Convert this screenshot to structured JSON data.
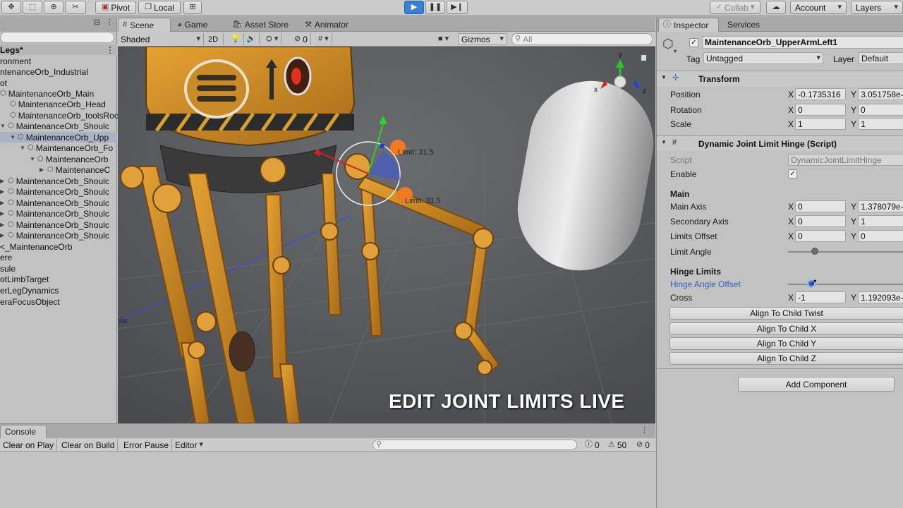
{
  "toolbar": {
    "pivot_label": "Pivot",
    "local_label": "Local",
    "collab_label": "Collab",
    "account_label": "Account",
    "layers_label": "Layers"
  },
  "hierarchy": {
    "rows": [
      {
        "label": "Legs*",
        "bold": true
      },
      {
        "label": "ronment"
      },
      {
        "label": "ntenanceOrb_Industrial"
      },
      {
        "label": "ot"
      },
      {
        "label": "MaintenanceOrb_Main"
      },
      {
        "label": "MaintenanceOrb_Head"
      },
      {
        "label": "MaintenanceOrb_toolsRoo"
      },
      {
        "label": "MaintenanceOrb_Shoulc"
      },
      {
        "label": "MaintenanceOrb_Upp"
      },
      {
        "label": "MaintenanceOrb_Fo"
      },
      {
        "label": "MaintenanceOrb"
      },
      {
        "label": "MaintenanceC"
      },
      {
        "label": "MaintenanceOrb_Shoulc"
      },
      {
        "label": "MaintenanceOrb_Shoulc"
      },
      {
        "label": "MaintenanceOrb_Shoulc"
      },
      {
        "label": "MaintenanceOrb_Shoulc"
      },
      {
        "label": "MaintenanceOrb_Shoulc"
      },
      {
        "label": "MaintenanceOrb_Shoulc"
      },
      {
        "label": "<_MaintenanceOrb"
      },
      {
        "label": "ere"
      },
      {
        "label": "sule"
      },
      {
        "label": "otLimbTarget"
      },
      {
        "label": "erLegDynamics"
      },
      {
        "label": "eraFocusObject"
      }
    ]
  },
  "scene": {
    "tabs": {
      "scene": "Scene",
      "game": "Game",
      "asset_store": "Asset Store",
      "animator": "Animator"
    },
    "shading_mode": "Shaded",
    "mode_2d": "2D",
    "hidden_count": "0",
    "gizmos_label": "Gizmos",
    "search_placeholder": "All",
    "limit_label_1": "Limit: 31.5",
    "limit_label_2": "Limit: 31.5",
    "axis_fragment": "xis",
    "caption": "EDIT JOINT LIMITS LIVE",
    "gizmo_axes": {
      "x": "x",
      "y": "y",
      "z": "z"
    }
  },
  "console": {
    "tab_label": "Console",
    "clear_on_play": "Clear on Play",
    "clear_on_build": "Clear on Build",
    "error_pause": "Error Pause",
    "editor": "Editor",
    "count_info": "0",
    "count_warn": "50",
    "count_error": "0"
  },
  "inspector": {
    "tab_inspector": "Inspector",
    "tab_services": "Services",
    "object_name": "MaintenanceOrb_UpperArmLeft1",
    "tag_label": "Tag",
    "tag_value": "Untagged",
    "layer_label": "Layer",
    "layer_value": "Default",
    "transform": {
      "title": "Transform",
      "position_label": "Position",
      "position_x": "-0.1735316",
      "position_y": "3.051758e-",
      "rotation_label": "Rotation",
      "rotation_x": "0",
      "rotation_y": "0",
      "scale_label": "Scale",
      "scale_x": "1",
      "scale_y": "1"
    },
    "script_comp": {
      "title": "Dynamic Joint Limit Hinge (Script)",
      "script_label": "Script",
      "script_value": "DynamicJointLimitHinge",
      "enable_label": "Enable",
      "main_header": "Main",
      "main_axis_label": "Main Axis",
      "main_axis_x": "0",
      "main_axis_y": "1.378079e-",
      "secondary_axis_label": "Secondary Axis",
      "secondary_axis_x": "0",
      "secondary_axis_y": "1",
      "limits_offset_label": "Limits Offset",
      "limits_offset_x": "0",
      "limits_offset_y": "0",
      "limit_angle_label": "Limit Angle",
      "limit_angle_level": 0.23,
      "hinge_limits_header": "Hinge Limits",
      "hinge_angle_offset_label": "Hinge Angle Offset",
      "hinge_angle_offset_level": 0.2,
      "cross_label": "Cross",
      "cross_x": "-1",
      "cross_y": "1.192093e-",
      "align_twist": "Align To Child Twist",
      "align_x": "Align To Child X",
      "align_y": "Align To Child Y",
      "align_z": "Align To Child Z"
    },
    "add_component": "Add Component",
    "axis_x": "X",
    "axis_y": "Y"
  }
}
